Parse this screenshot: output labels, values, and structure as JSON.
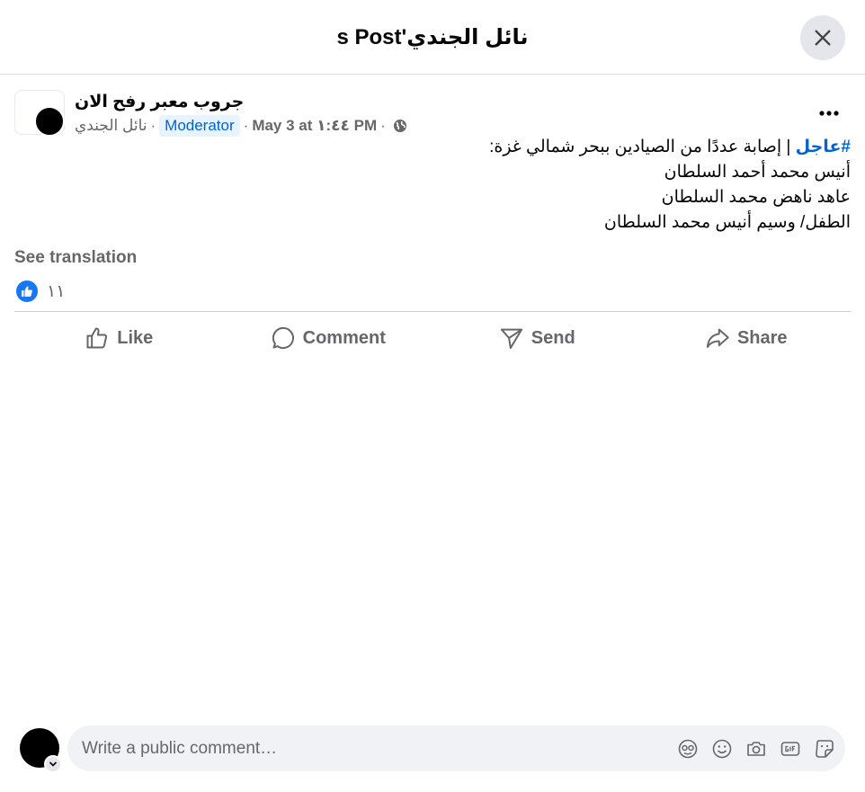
{
  "header": {
    "title": "نائل الجندي's Post"
  },
  "post": {
    "group_name": "جروب معبر رفح الان",
    "author": "نائل الجندي",
    "role_badge": "Moderator",
    "date": "May 3 at ١:٤٤ PM",
    "hashtag": "#عاجل",
    "lines": [
      " | إصابة عددًا من الصيادين ببحر شمالي غزة:",
      "أنيس محمد أحمد السلطان",
      "عاهد ناهض محمد السلطان",
      "الطفل/ وسيم أنيس محمد السلطان"
    ],
    "see_translation": "See translation",
    "reaction_count": "١١"
  },
  "actions": {
    "like": "Like",
    "comment": "Comment",
    "send": "Send",
    "share": "Share"
  },
  "comment_bar": {
    "placeholder": "Write a public comment…"
  },
  "icons": {
    "close": "close-icon",
    "more": "more-icon",
    "globe": "globe-icon",
    "like": "thumbs-up-icon",
    "comment": "comment-icon",
    "send": "send-icon",
    "share": "share-icon",
    "avatar_sticker": "avatar-sticker-icon",
    "emoji": "emoji-icon",
    "camera": "camera-icon",
    "gif": "gif-icon",
    "sticker": "sticker-icon"
  },
  "colors": {
    "accent": "#0064d1",
    "like_blue": "#1877f2",
    "secondary_text": "#65676b"
  }
}
